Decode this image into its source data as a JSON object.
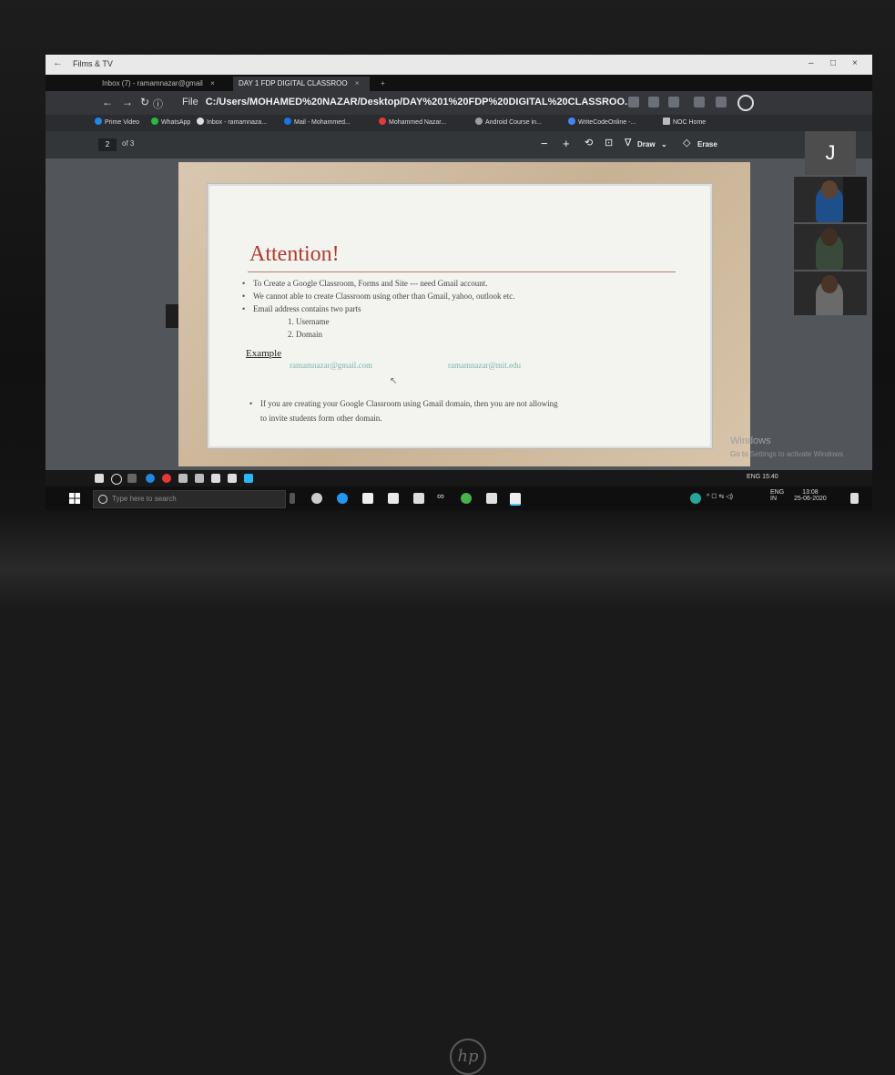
{
  "app_title": "Films & TV",
  "browser": {
    "tabs": [
      {
        "label": "Inbox (7) - ramamnazar@gmail",
        "close": "×"
      },
      {
        "label": "DAY 1 FDP DIGITAL CLASSROO",
        "close": "×"
      }
    ],
    "new_tab": "+",
    "file_label": "File",
    "url": "C:/Users/MOHAMED%20NAZAR/Desktop/DAY%201%20FDP%20DIGITAL%20CLASSROO...",
    "bookmarks": [
      "Prime Video",
      "WhatsApp",
      "Inbox - ramamnaza...",
      "Mail - Mohammed...",
      "Mohammed Nazar...",
      "Android Course in...",
      "WriteCodeOnline -...",
      "NOC Home"
    ]
  },
  "pdf_toolbar": {
    "page": "2",
    "of": "of 3",
    "zoom_out": "−",
    "zoom_in": "+",
    "draw": "Draw",
    "erase": "Erase"
  },
  "slide": {
    "title": "Attention!",
    "bullets": [
      "To Create a Google Classroom, Forms and Site --- need Gmail account.",
      "We cannot able to create Classroom using other than Gmail, yahoo, outlook etc.",
      "Email address contains two parts"
    ],
    "parts": [
      "1. Username",
      "2. Domain"
    ],
    "example_heading": "Example",
    "examples": [
      "ramamnazar@gmail.com",
      "ramamnazar@mit.edu"
    ],
    "note_line1": "If you are creating your Google Classroom using Gmail domain, then you are not allowing",
    "note_line2": "to invite students form other domain."
  },
  "watermark": {
    "title": "Windows",
    "subtitle": "Go to Settings to activate Windows"
  },
  "meeting": {
    "initial": "J"
  },
  "remote_taskbar": {
    "tray": "ENG  15:40"
  },
  "local_taskbar": {
    "search_placeholder": "Type here to search",
    "lang_top": "ENG",
    "lang_bottom": "IN",
    "time": "13:08",
    "date": "25-06-2020"
  },
  "brand": "hp",
  "colors": {
    "slide_title": "#b23a2e",
    "email": "#7ab5a8",
    "screen_bg": "#202124"
  }
}
